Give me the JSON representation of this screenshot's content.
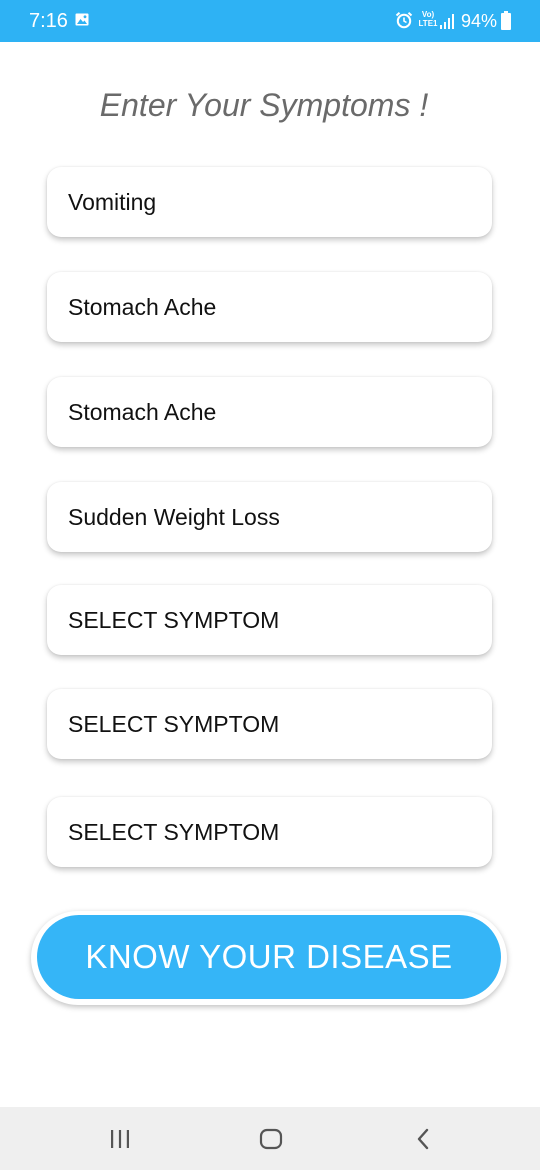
{
  "status_bar": {
    "time": "7:16",
    "volte_line1": "Vo)",
    "volte_line2": "LTE1",
    "battery": "94%",
    "background_color": "#2eb2f4"
  },
  "page": {
    "title": "Enter Your Symptoms !"
  },
  "symptoms": [
    {
      "value": "Vomiting"
    },
    {
      "value": "Stomach Ache"
    },
    {
      "value": "Stomach Ache"
    },
    {
      "value": "Sudden Weight Loss"
    },
    {
      "value": "SELECT SYMPTOM"
    },
    {
      "value": "SELECT SYMPTOM"
    },
    {
      "value": "SELECT SYMPTOM"
    }
  ],
  "actions": {
    "know_disease_label": "KNOW YOUR DISEASE",
    "button_color": "#35b5f7"
  },
  "nav_bar": {
    "icons": [
      "recent-apps-icon",
      "home-icon",
      "back-icon"
    ]
  }
}
